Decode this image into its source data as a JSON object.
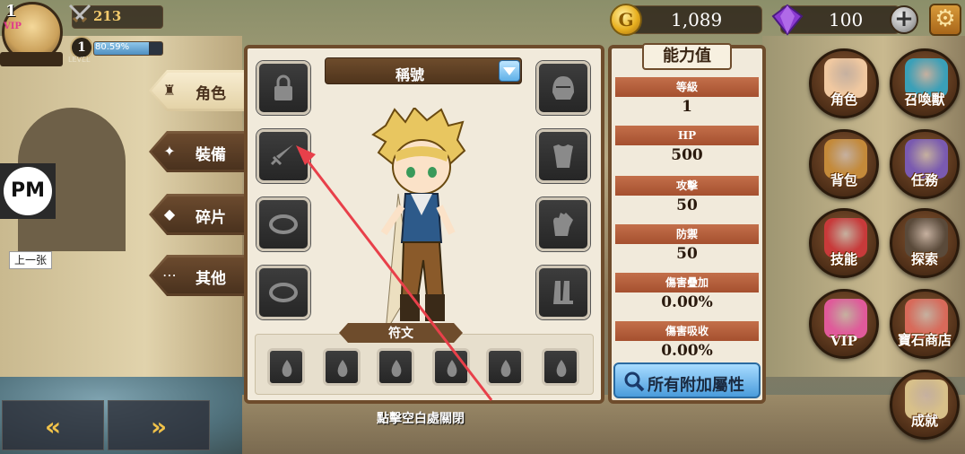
{
  "player": {
    "vip_level": "1",
    "vip_tag": "VIP",
    "power": "213",
    "level": "1",
    "level_label": "LEVEL",
    "exp_text": "80.59%",
    "exp_fraction": 0.8059
  },
  "currency": {
    "gold_icon": "G",
    "gold": "1,089",
    "gems": "100",
    "plus_glyph": "+",
    "gear_glyph": "⚙"
  },
  "categories": [
    {
      "label": "角色",
      "icon": "♜",
      "active": true
    },
    {
      "label": "裝備",
      "icon": "✦",
      "active": false
    },
    {
      "label": "碎片",
      "icon": "◆",
      "active": false
    },
    {
      "label": "其他",
      "icon": "⋯",
      "active": false
    }
  ],
  "pm_logo": "PM",
  "prev_label": "上一张",
  "nav": {
    "left": "«",
    "right": "»"
  },
  "equipment": {
    "title_dropdown": "稱號",
    "rune_label": "符文",
    "close_hint": "點擊空白處關閉"
  },
  "stats": {
    "title": "能力值",
    "rows": [
      {
        "label": "等級",
        "value": "1"
      },
      {
        "label": "HP",
        "value": "500"
      },
      {
        "label": "攻擊",
        "value": "50"
      },
      {
        "label": "防禦",
        "value": "50"
      },
      {
        "label": "傷害疊加",
        "value": "0.00%"
      },
      {
        "label": "傷害吸收",
        "value": "0.00%"
      }
    ],
    "all_attr_button": "所有附加屬性"
  },
  "menu": [
    {
      "label": "角色",
      "color": "#f0c8a0"
    },
    {
      "label": "召喚獸",
      "color": "#3aa0b8"
    },
    {
      "label": "背包",
      "color": "#c48a3a"
    },
    {
      "label": "任務",
      "color": "#7a5ab0"
    },
    {
      "label": "技能",
      "color": "#c83a3a"
    },
    {
      "label": "探索",
      "color": "#5a4a3a"
    },
    {
      "label": "VIP",
      "color": "#e05a9a"
    },
    {
      "label": "寶石商店",
      "color": "#d86a5a"
    },
    {
      "label": "成就",
      "color": "#d8c08a"
    }
  ],
  "colors": {
    "panel_border": "#6e4c2c",
    "stat_header": "#b45c3a",
    "accent_blue": "#4a9cdc",
    "annotation_red": "#e8404a"
  }
}
